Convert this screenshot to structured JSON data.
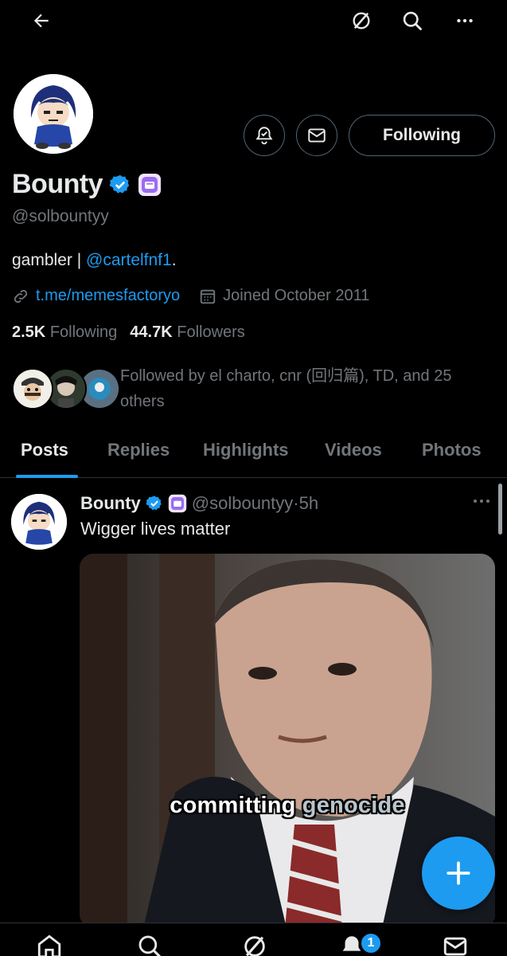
{
  "profile": {
    "name": "Bounty",
    "handle": "@solbountyy",
    "bio_text": "gambler | ",
    "bio_mention": "@cartelfnf1",
    "bio_suffix": ".",
    "link": "t.me/memesfactoryo",
    "joined": "Joined October 2011",
    "following_count": "2.5K",
    "following_label": "Following",
    "followers_count": "44.7K",
    "followers_label": "Followers",
    "followed_by": "Followed by el charto, cnr (回归篇), TD, and 25 others"
  },
  "actions": {
    "following_button": "Following"
  },
  "tabs": [
    {
      "label": "Posts",
      "active": true
    },
    {
      "label": "Replies"
    },
    {
      "label": "Highlights"
    },
    {
      "label": "Videos"
    },
    {
      "label": "Photos"
    }
  ],
  "post": {
    "name": "Bounty",
    "handle": "@solbountyy",
    "dot": "·",
    "time": "5h",
    "text": "Wigger lives matter",
    "caption_a": "committing",
    "caption_b": " genocide"
  },
  "nav": {
    "notification_badge": "1"
  },
  "colors": {
    "accent": "#1d9bf0",
    "background": "#000000",
    "muted": "#71767b",
    "text": "#e7e9ea",
    "border": "#2f3336"
  },
  "icons": [
    "back-arrow-icon",
    "grok-icon",
    "search-icon",
    "more-icon",
    "bell-check-icon",
    "mail-icon",
    "verified-icon",
    "affiliate-badge-icon",
    "link-icon",
    "calendar-icon",
    "plus-icon",
    "home-icon",
    "notifications-icon"
  ]
}
